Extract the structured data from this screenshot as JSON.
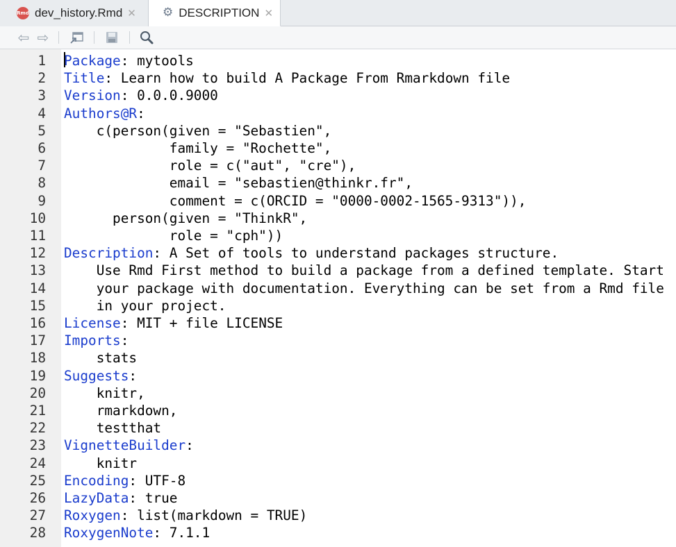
{
  "tabs": [
    {
      "label": "dev_history.Rmd",
      "icon": "rmd-file-icon"
    },
    {
      "label": "DESCRIPTION",
      "icon": "gear-icon"
    }
  ],
  "colors": {
    "key": "#1a3ccd",
    "gutter": "#f0f0f0"
  },
  "lines": [
    {
      "num": "1",
      "key": "Package",
      "rest": ": mytools"
    },
    {
      "num": "2",
      "key": "Title",
      "rest": ": Learn how to build A Package From Rmarkdown file"
    },
    {
      "num": "3",
      "key": "Version",
      "rest": ": 0.0.0.9000"
    },
    {
      "num": "4",
      "key": "Authors@R",
      "rest": ":"
    },
    {
      "num": "5",
      "key": "",
      "rest": "    c(person(given = \"Sebastien\","
    },
    {
      "num": "6",
      "key": "",
      "rest": "             family = \"Rochette\","
    },
    {
      "num": "7",
      "key": "",
      "rest": "             role = c(\"aut\", \"cre\"),"
    },
    {
      "num": "8",
      "key": "",
      "rest": "             email = \"sebastien@thinkr.fr\","
    },
    {
      "num": "9",
      "key": "",
      "rest": "             comment = c(ORCID = \"0000-0002-1565-9313\")),"
    },
    {
      "num": "10",
      "key": "",
      "rest": "      person(given = \"ThinkR\","
    },
    {
      "num": "11",
      "key": "",
      "rest": "             role = \"cph\"))"
    },
    {
      "num": "12",
      "key": "Description",
      "rest": ": A Set of tools to understand packages structure."
    },
    {
      "num": "13",
      "key": "",
      "rest": "    Use Rmd First method to build a package from a defined template. Start"
    },
    {
      "num": "14",
      "key": "",
      "rest": "    your package with documentation. Everything can be set from a Rmd file"
    },
    {
      "num": "15",
      "key": "",
      "rest": "    in your project."
    },
    {
      "num": "16",
      "key": "License",
      "rest": ": MIT + file LICENSE"
    },
    {
      "num": "17",
      "key": "Imports",
      "rest": ":"
    },
    {
      "num": "18",
      "key": "",
      "rest": "    stats"
    },
    {
      "num": "19",
      "key": "Suggests",
      "rest": ":"
    },
    {
      "num": "20",
      "key": "",
      "rest": "    knitr,"
    },
    {
      "num": "21",
      "key": "",
      "rest": "    rmarkdown,"
    },
    {
      "num": "22",
      "key": "",
      "rest": "    testthat"
    },
    {
      "num": "23",
      "key": "VignetteBuilder",
      "rest": ":"
    },
    {
      "num": "24",
      "key": "",
      "rest": "    knitr"
    },
    {
      "num": "25",
      "key": "Encoding",
      "rest": ": UTF-8"
    },
    {
      "num": "26",
      "key": "LazyData",
      "rest": ": true"
    },
    {
      "num": "27",
      "key": "Roxygen",
      "rest": ": list(markdown = TRUE)"
    },
    {
      "num": "28",
      "key": "RoxygenNote",
      "rest": ": 7.1.1"
    }
  ]
}
